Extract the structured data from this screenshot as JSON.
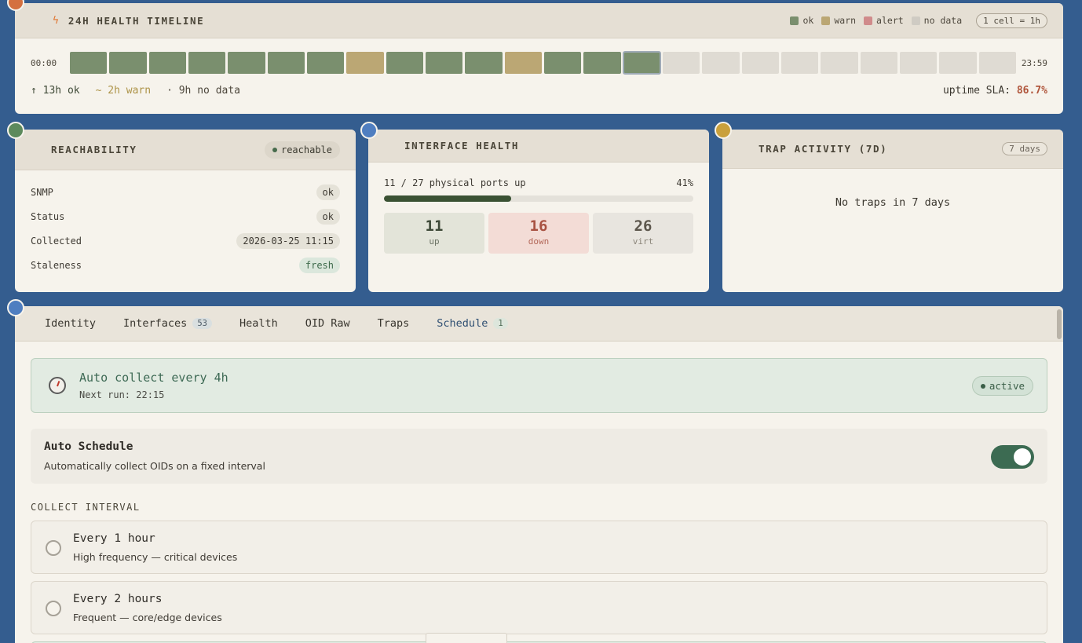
{
  "timeline": {
    "title": "24H HEALTH TIMELINE",
    "legend": [
      {
        "label": "ok",
        "color": "#7a8f6e"
      },
      {
        "label": "warn",
        "color": "#bba774"
      },
      {
        "label": "alert",
        "color": "#d08b8b"
      },
      {
        "label": "no data",
        "color": "#cfcbc3"
      }
    ],
    "cell_scale": "1 cell = 1h",
    "start_label": "00:00",
    "end_label": "23:59",
    "cells": [
      "ok",
      "ok",
      "ok",
      "ok",
      "ok",
      "ok",
      "ok",
      "warn",
      "ok",
      "ok",
      "ok",
      "warn",
      "ok",
      "ok",
      "ok",
      "nd",
      "nd",
      "nd",
      "nd",
      "nd",
      "nd",
      "nd",
      "nd",
      "nd"
    ],
    "current_index": 14,
    "ok_summary": "↑ 13h ok",
    "warn_summary": "~ 2h warn",
    "nodata_summary": "· 9h no data",
    "sla_label": "uptime SLA:",
    "sla_value": "86.7%"
  },
  "reachability": {
    "title": "REACHABILITY",
    "status_pill": "reachable",
    "rows": [
      {
        "key": "SNMP",
        "value": "ok"
      },
      {
        "key": "Status",
        "value": "ok"
      },
      {
        "key": "Collected",
        "value": "2026-03-25 11:15"
      },
      {
        "key": "Staleness",
        "value": "fresh"
      }
    ]
  },
  "interface_health": {
    "title": "INTERFACE HEALTH",
    "ports_text": "11 / 27 physical ports up",
    "percent_label": "41%",
    "percent_value": 41,
    "stats": [
      {
        "value": "11",
        "label": "up"
      },
      {
        "value": "16",
        "label": "down"
      },
      {
        "value": "26",
        "label": "virt"
      }
    ]
  },
  "trap_activity": {
    "title": "TRAP ACTIVITY (7D)",
    "range_pill": "7 days",
    "empty_text": "No traps in 7 days"
  },
  "tabs": [
    {
      "label": "Identity"
    },
    {
      "label": "Interfaces",
      "count": "53"
    },
    {
      "label": "Health"
    },
    {
      "label": "OID Raw"
    },
    {
      "label": "Traps"
    },
    {
      "label": "Schedule",
      "count": "1"
    }
  ],
  "schedule": {
    "banner_title": "Auto collect every 4h",
    "banner_sub": "Next run: 22:15",
    "banner_status": "active",
    "auto_title": "Auto Schedule",
    "auto_sub": "Automatically collect OIDs on a fixed interval",
    "auto_enabled": true,
    "interval_label": "COLLECT INTERVAL",
    "options": [
      {
        "title": "Every 1 hour",
        "sub": "High frequency — critical devices"
      },
      {
        "title": "Every 2 hours",
        "sub": "Frequent — core/edge devices"
      }
    ]
  },
  "colors": {
    "marker_orange": "#d4703f",
    "marker_green": "#5d8a5c",
    "marker_blue": "#4f7ec0",
    "marker_gold": "#c9a03c"
  }
}
